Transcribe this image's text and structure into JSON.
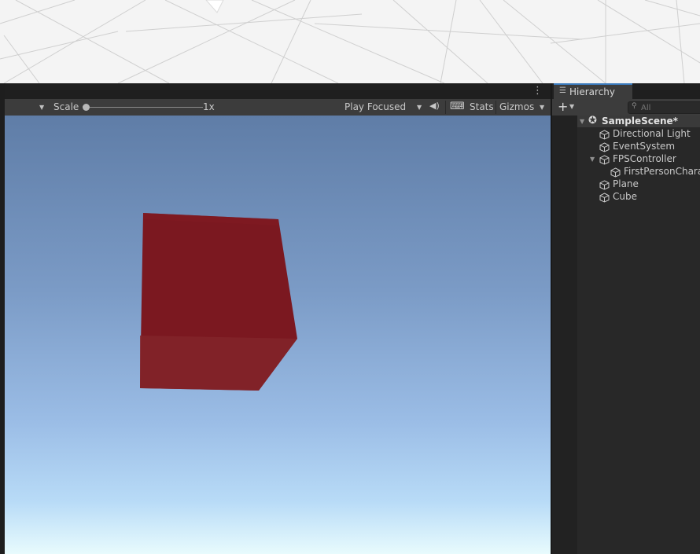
{
  "game_toolbar": {
    "scale_label": "Scale",
    "scale_value": "1x",
    "scale_level": 0,
    "play_mode": "Play Focused",
    "stats_label": "Stats",
    "gizmos_label": "Gizmos"
  },
  "hierarchy": {
    "tab_label": "Hierarchy",
    "add_label": "+",
    "search_placeholder": "All",
    "scene": "SampleScene*",
    "items": [
      {
        "label": "Directional Light",
        "icon": "cube-outline-icon"
      },
      {
        "label": "EventSystem",
        "icon": "cube-outline-icon"
      },
      {
        "label": "FPSController",
        "icon": "cube-outline-icon",
        "expanded": true
      },
      {
        "label": "FirstPersonCharac",
        "icon": "cube-outline-icon"
      },
      {
        "label": "Plane",
        "icon": "cube-outline-icon"
      },
      {
        "label": "Cube",
        "icon": "cube-outline-icon"
      }
    ]
  },
  "colors": {
    "cube_red": "#7d1820",
    "sky_top": "#5f7da7",
    "sky_horizon": "#e8fbfd",
    "panel": "#282828",
    "toolbar": "#3c3c3c",
    "accent": "#3a79bb"
  }
}
